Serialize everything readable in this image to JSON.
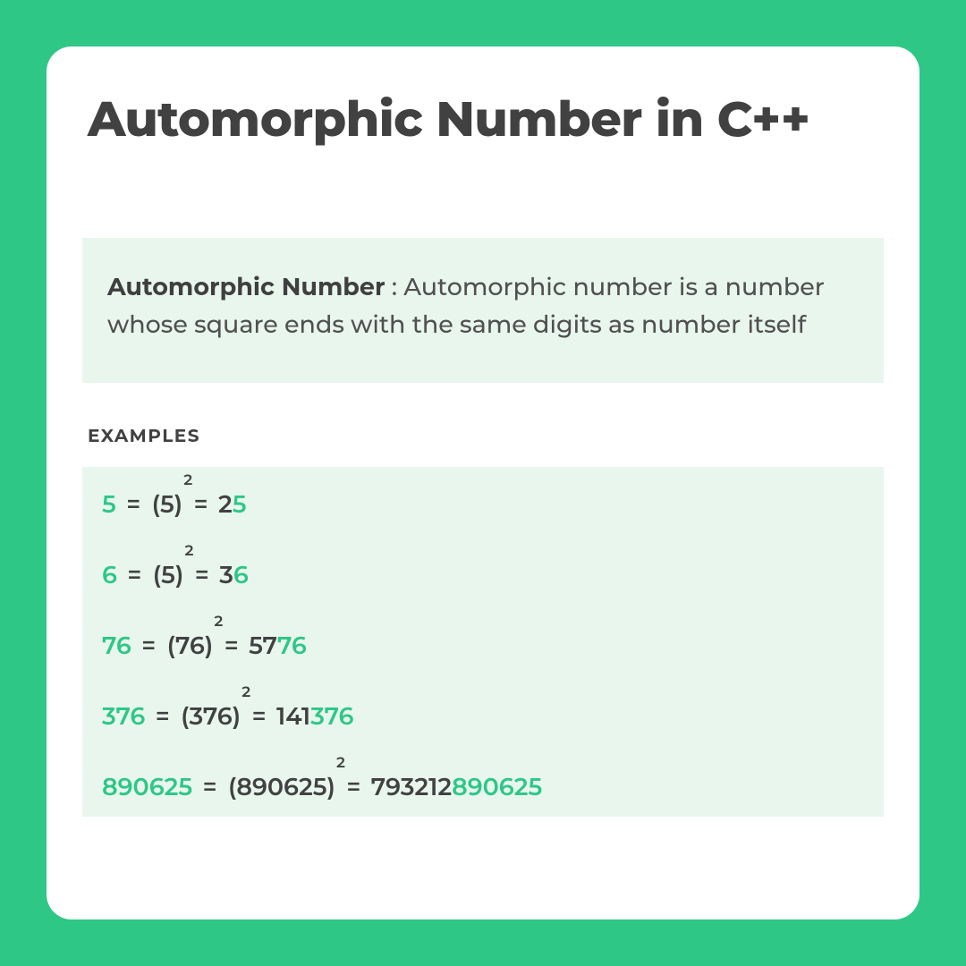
{
  "title": "Automorphic Number in C++",
  "definition": {
    "term": "Automorphic Number",
    "text": " : Automorphic number is a number whose square ends with the same digits as number itself"
  },
  "examples_label": "EXAMPLES",
  "examples": [
    {
      "num": "5",
      "base": "5",
      "exp": "2",
      "result_prefix": "2",
      "result_suffix": "5"
    },
    {
      "num": "6",
      "base": "5",
      "exp": "2",
      "result_prefix": "3",
      "result_suffix": "6"
    },
    {
      "num": "76",
      "base": "76",
      "exp": "2",
      "result_prefix": "57",
      "result_suffix": "76"
    },
    {
      "num": "376",
      "base": "376",
      "exp": "2",
      "result_prefix": "141",
      "result_suffix": "376"
    },
    {
      "num": "890625",
      "base": "890625",
      "exp": "2",
      "result_prefix": "793212",
      "result_suffix": "890625"
    }
  ]
}
